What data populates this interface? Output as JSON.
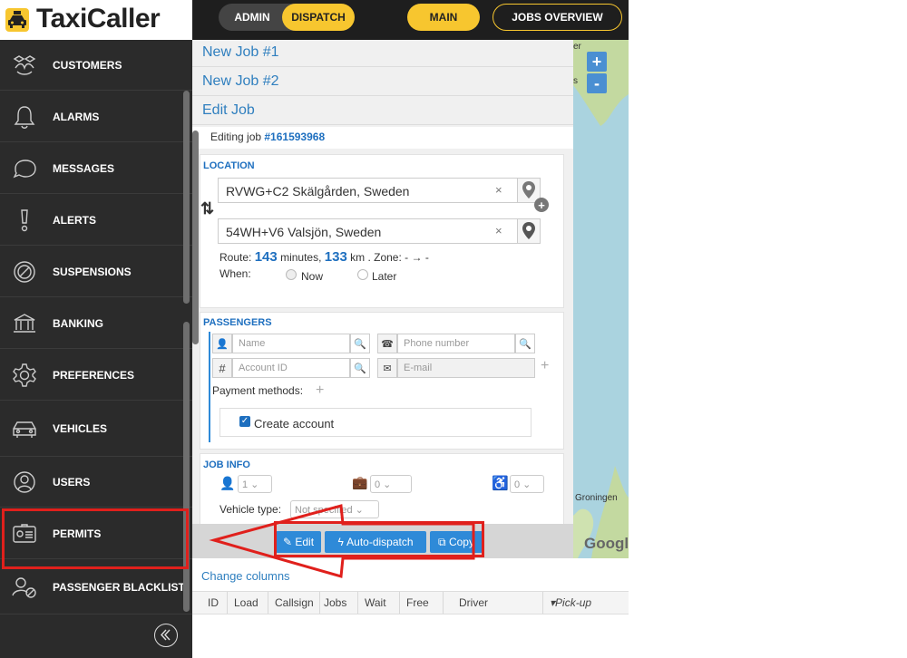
{
  "app": {
    "title": "TaxiCaller"
  },
  "topnav": {
    "admin": "ADMIN",
    "dispatch": "DISPATCH",
    "main": "MAIN",
    "jobs_overview": "JOBS OVERVIEW"
  },
  "sidebar": {
    "items": [
      {
        "label": "CUSTOMERS",
        "icon": "customers-icon"
      },
      {
        "label": "ALARMS",
        "icon": "bell-icon"
      },
      {
        "label": "MESSAGES",
        "icon": "chat-bubble-icon"
      },
      {
        "label": "ALERTS",
        "icon": "exclamation-icon"
      },
      {
        "label": "SUSPENSIONS",
        "icon": "ban-icon"
      },
      {
        "label": "BANKING",
        "icon": "bank-icon"
      },
      {
        "label": "PREFERENCES",
        "icon": "gear-icon"
      },
      {
        "label": "VEHICLES",
        "icon": "car-icon"
      },
      {
        "label": "USERS",
        "icon": "user-icon"
      },
      {
        "label": "PERMITS",
        "icon": "permit-card-icon"
      },
      {
        "label": "PASSENGER BLACKLIST",
        "icon": "blacklist-user-icon"
      }
    ]
  },
  "jobs": {
    "tabs": [
      "New Job #1",
      "New Job #2",
      "Edit Job"
    ],
    "editing_prefix": "Editing job ",
    "editing_id": "#161593968"
  },
  "location": {
    "title": "LOCATION",
    "from": "RVWG+C2 Skälgården, Sweden",
    "to": "54WH+V6 Valsjön, Sweden",
    "route_prefix": "Route: ",
    "route_minutes": "143",
    "route_mid": " minutes, ",
    "route_km": "133",
    "route_suffix": " km . Zone: - → -",
    "when_label": "When:",
    "now_label": "Now",
    "later_label": "Later",
    "clear": "×"
  },
  "passengers": {
    "title": "PASSENGERS",
    "name_placeholder": "Name",
    "phone_placeholder": "Phone number",
    "account_placeholder": "Account ID",
    "email_placeholder": "E-mail",
    "payment_label": "Payment methods:",
    "create_account_label": "Create account",
    "create_account_checked": true
  },
  "job_info": {
    "title": "JOB INFO",
    "passengers_count": "1",
    "luggage_count": "0",
    "wheelchair_count": "0",
    "vehicle_type_label": "Vehicle type:",
    "vehicle_type_value": "Not specified"
  },
  "toolbar": {
    "edit": "Edit",
    "auto_dispatch": "Auto-dispatch",
    "copy": "Copy"
  },
  "table": {
    "change_columns": "Change columns",
    "columns": [
      "ID",
      "Load",
      "Callsign",
      "Jobs",
      "Wait",
      "Free",
      "Driver",
      "Pick-up"
    ]
  },
  "map": {
    "zoom_in": "+",
    "zoom_out": "-",
    "label_groningen": "Groningen",
    "label_google": "Googl",
    "label_er": "er",
    "label_s": "s"
  },
  "colors": {
    "accent_yellow": "#f7c62f",
    "link_blue": "#2f7fbf",
    "button_blue": "#2e8ad8",
    "annotation_red": "#e0201c",
    "sidebar_bg": "#2b2b2b"
  }
}
